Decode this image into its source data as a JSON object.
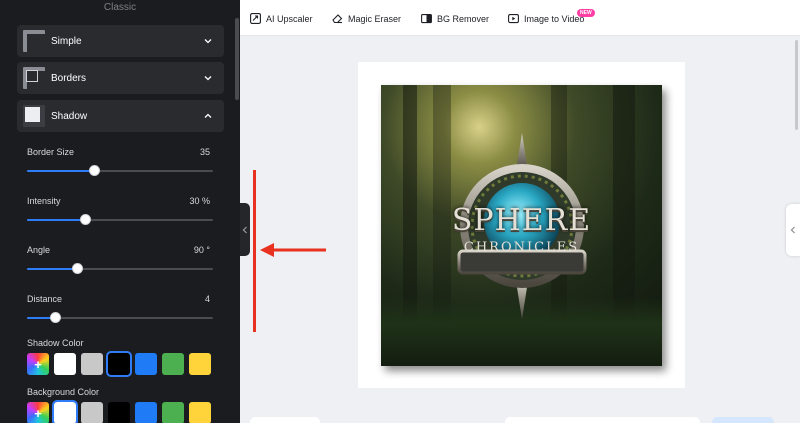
{
  "panel": {
    "header": "Classic",
    "sections": [
      {
        "label": "Simple",
        "expanded": false
      },
      {
        "label": "Borders",
        "expanded": false
      },
      {
        "label": "Shadow",
        "expanded": true
      }
    ],
    "sliders": [
      {
        "label": "Border Size",
        "value": "35",
        "level": 0.36
      },
      {
        "label": "Intensity",
        "value": "30 %",
        "level": 0.31
      },
      {
        "label": "Angle",
        "value": "90 °",
        "level": 0.27
      },
      {
        "label": "Distance",
        "value": "4",
        "level": 0.15
      }
    ],
    "shadow_color": {
      "label": "Shadow Color",
      "swatches": [
        "picker",
        "#ffffff",
        "#c8c8c8",
        "#000000",
        "#1f7cf6",
        "#4caf50",
        "#ffd43b"
      ],
      "selected_index": 3
    },
    "background_color": {
      "label": "Background Color",
      "swatches": [
        "picker",
        "#ffffff",
        "#c8c8c8",
        "#000000",
        "#1f7cf6",
        "#4caf50",
        "#ffd43b"
      ],
      "selected_index": 1
    }
  },
  "toolbar": {
    "tools": [
      {
        "label": "AI Upscaler",
        "icon": "upscale-icon"
      },
      {
        "label": "Magic Eraser",
        "icon": "eraser-icon"
      },
      {
        "label": "BG Remover",
        "icon": "bg-remover-icon"
      },
      {
        "label": "Image to Video",
        "icon": "video-icon",
        "badge": "NEW"
      }
    ]
  },
  "canvas": {
    "title_big": "SPHERE",
    "title_small": "CHRONICLES"
  },
  "colors": {
    "accent": "#2f7df6",
    "panel_bg": "#1b1c1f",
    "annotation": "#e8321f",
    "badge": "#ff3fa6"
  }
}
